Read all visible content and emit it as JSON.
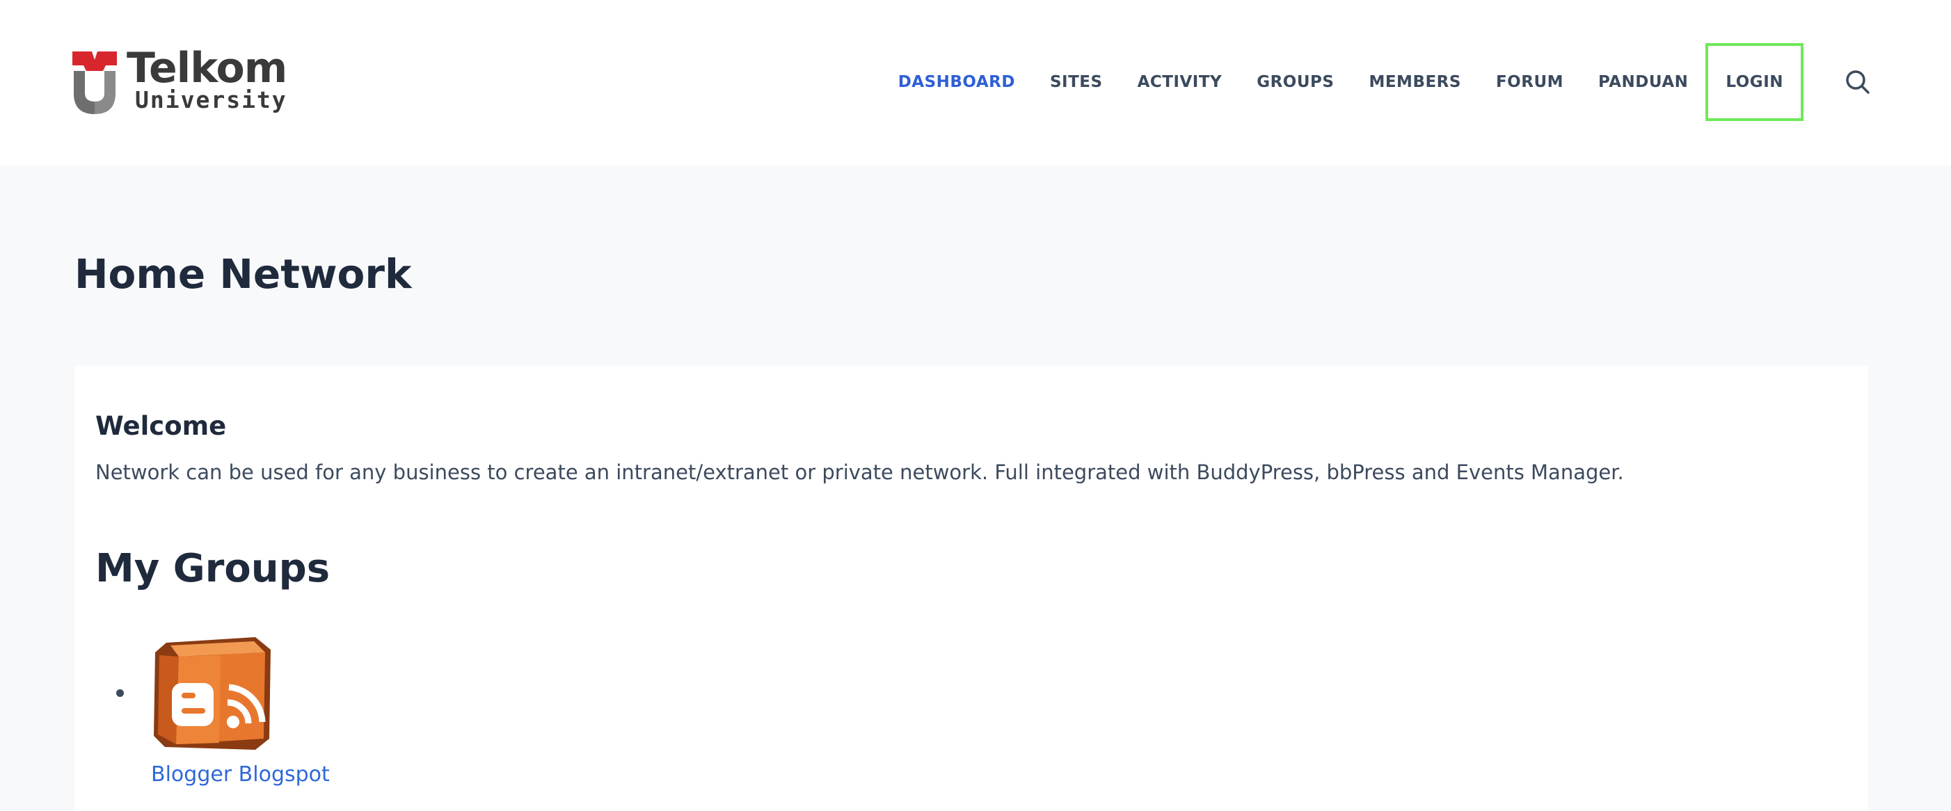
{
  "brand": {
    "name": "Telkom",
    "subtitle": "University",
    "logo_color": "#d7272d"
  },
  "nav": {
    "items": [
      {
        "label": "DASHBOARD",
        "active": true
      },
      {
        "label": "SITES",
        "active": false
      },
      {
        "label": "ACTIVITY",
        "active": false
      },
      {
        "label": "GROUPS",
        "active": false
      },
      {
        "label": "MEMBERS",
        "active": false
      },
      {
        "label": "FORUM",
        "active": false
      },
      {
        "label": "PANDUAN",
        "active": false
      },
      {
        "label": "LOGIN",
        "active": false,
        "highlighted": true
      }
    ],
    "search_icon": "search-icon",
    "active_color": "#2f5fd6",
    "highlight_color": "#6fe85a"
  },
  "page": {
    "title": "Home Network"
  },
  "welcome": {
    "title": "Welcome",
    "text": "Network can be used for any business to create an intranet/extranet or private network. Full integrated with BuddyPress, bbPress and Events Manager."
  },
  "groups": {
    "title": "My Groups",
    "items": [
      {
        "name": "Blogger Blogspot",
        "icon": "blogger-rss-cube-icon"
      }
    ]
  }
}
